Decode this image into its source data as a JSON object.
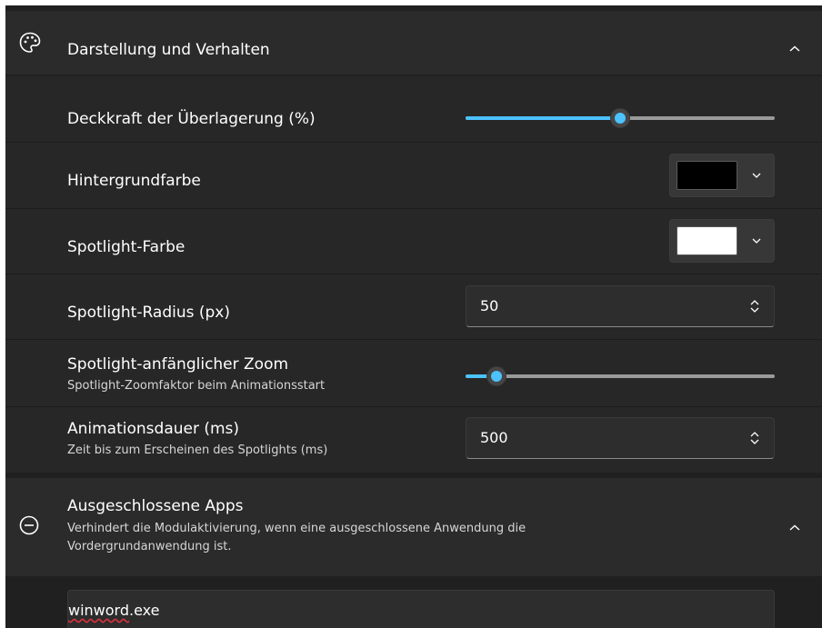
{
  "appearance": {
    "title": "Darstellung und Verhalten",
    "icon": "palette-icon",
    "collapse_icon": "chevron-up-icon"
  },
  "settings": {
    "overlay_opacity": {
      "label": "Deckkraft der Überlagerung (%)",
      "value_fraction": 0.5
    },
    "background_color": {
      "label": "Hintergrundfarbe",
      "color": "#000000"
    },
    "spotlight_color": {
      "label": "Spotlight-Farbe",
      "color": "#ffffff"
    },
    "spotlight_radius": {
      "label": "Spotlight-Radius (px)",
      "value": "50"
    },
    "spotlight_zoom": {
      "label": "Spotlight-anfänglicher Zoom",
      "description": "Spotlight-Zoomfaktor beim Animationsstart",
      "value_fraction": 0.1
    },
    "animation_duration": {
      "label": "Animationsdauer (ms)",
      "description": "Zeit bis zum Erscheinen des Spotlights (ms)",
      "value": "500"
    }
  },
  "excluded_apps": {
    "title": "Ausgeschlossene Apps",
    "description_line1": "Verhindert die Modulaktivierung, wenn eine ausgeschlossene Anwendung die",
    "description_line2": "Vordergrundanwendung ist.",
    "icon": "minus-circle-icon",
    "collapse_icon": "chevron-up-icon",
    "list_prefix": "",
    "list_value_word": "winword",
    "list_value_ext": ".exe"
  },
  "colors": {
    "accent": "#4cc2ff",
    "background": "#202020",
    "card": "#272727"
  }
}
